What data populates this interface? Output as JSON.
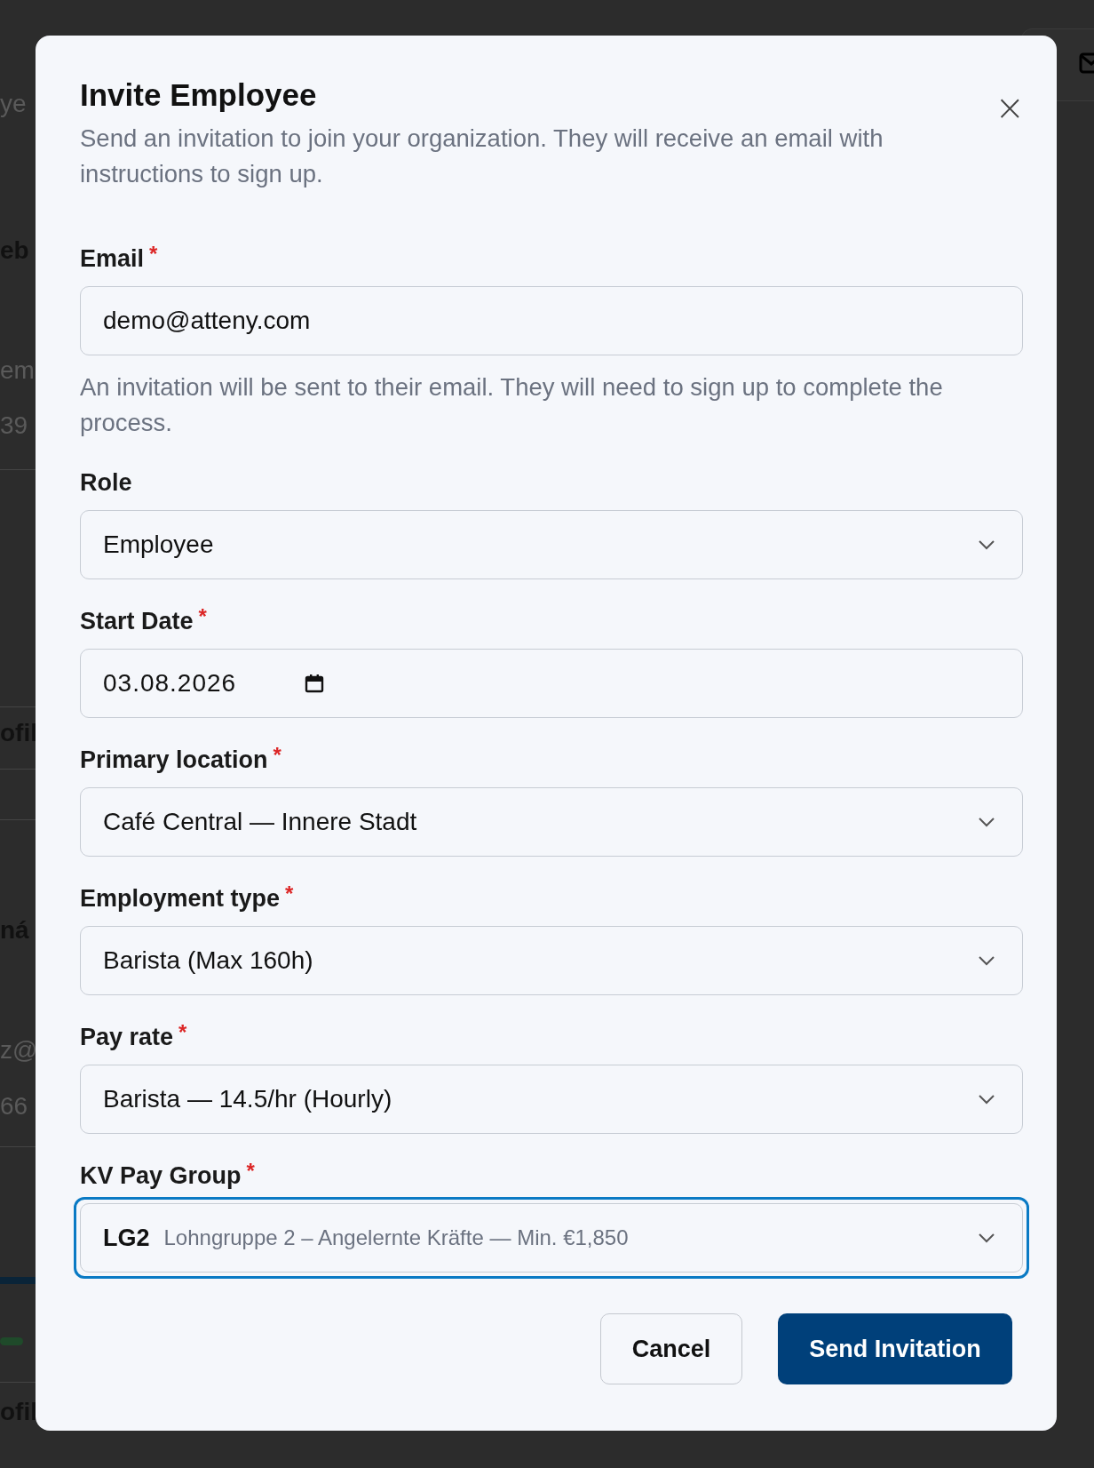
{
  "background": {
    "fragments": [
      {
        "text": "ye",
        "kind": "muted"
      },
      {
        "text": "eb",
        "kind": "bold"
      },
      {
        "text": "em",
        "kind": "muted"
      },
      {
        "text": "39",
        "kind": "muted"
      },
      {
        "text": "ofil",
        "kind": "bold"
      },
      {
        "text": "ná",
        "kind": "bold"
      },
      {
        "text": "z@",
        "kind": "muted"
      },
      {
        "text": "66",
        "kind": "muted"
      },
      {
        "text": "ofil",
        "kind": "bold"
      }
    ]
  },
  "dialog": {
    "title": "Invite Employee",
    "close": "×",
    "description": "Send an invitation to join your organization. They will receive an email with instructions to sign up.",
    "fields": [
      {
        "kind": "text",
        "label": "Email",
        "required_mark": "*",
        "value": "demo@atteny.com",
        "help": "An invitation will be sent to their email. They will need to sign up to complete the process.",
        "focused": false
      },
      {
        "kind": "select",
        "label": "Role",
        "value": "Employee",
        "focused": false
      },
      {
        "kind": "date",
        "label": "Start Date",
        "required_mark": "*",
        "value": "03.08.2026",
        "focused": false
      },
      {
        "kind": "select",
        "label": "Primary location",
        "required_mark": "*",
        "value": "Café Central — Innere Stadt",
        "focused": false
      },
      {
        "kind": "select",
        "label": "Employment type",
        "required_mark": "*",
        "value": "Barista (Max 160h)",
        "focused": false
      },
      {
        "kind": "select",
        "label": "Pay rate",
        "required_mark": "*",
        "value": "Barista — 14.5/hr (Hourly)",
        "focused": false
      },
      {
        "kind": "select_code",
        "label": "KV Pay Group",
        "required_mark": "*",
        "code": "LG2",
        "description": "Lohngruppe 2 – Angelernte Kräfte — Min. €1,850",
        "focused": true
      }
    ],
    "buttons": [
      {
        "label": "Cancel",
        "kind": "secondary"
      },
      {
        "label": "Send Invitation",
        "kind": "primary"
      }
    ]
  }
}
